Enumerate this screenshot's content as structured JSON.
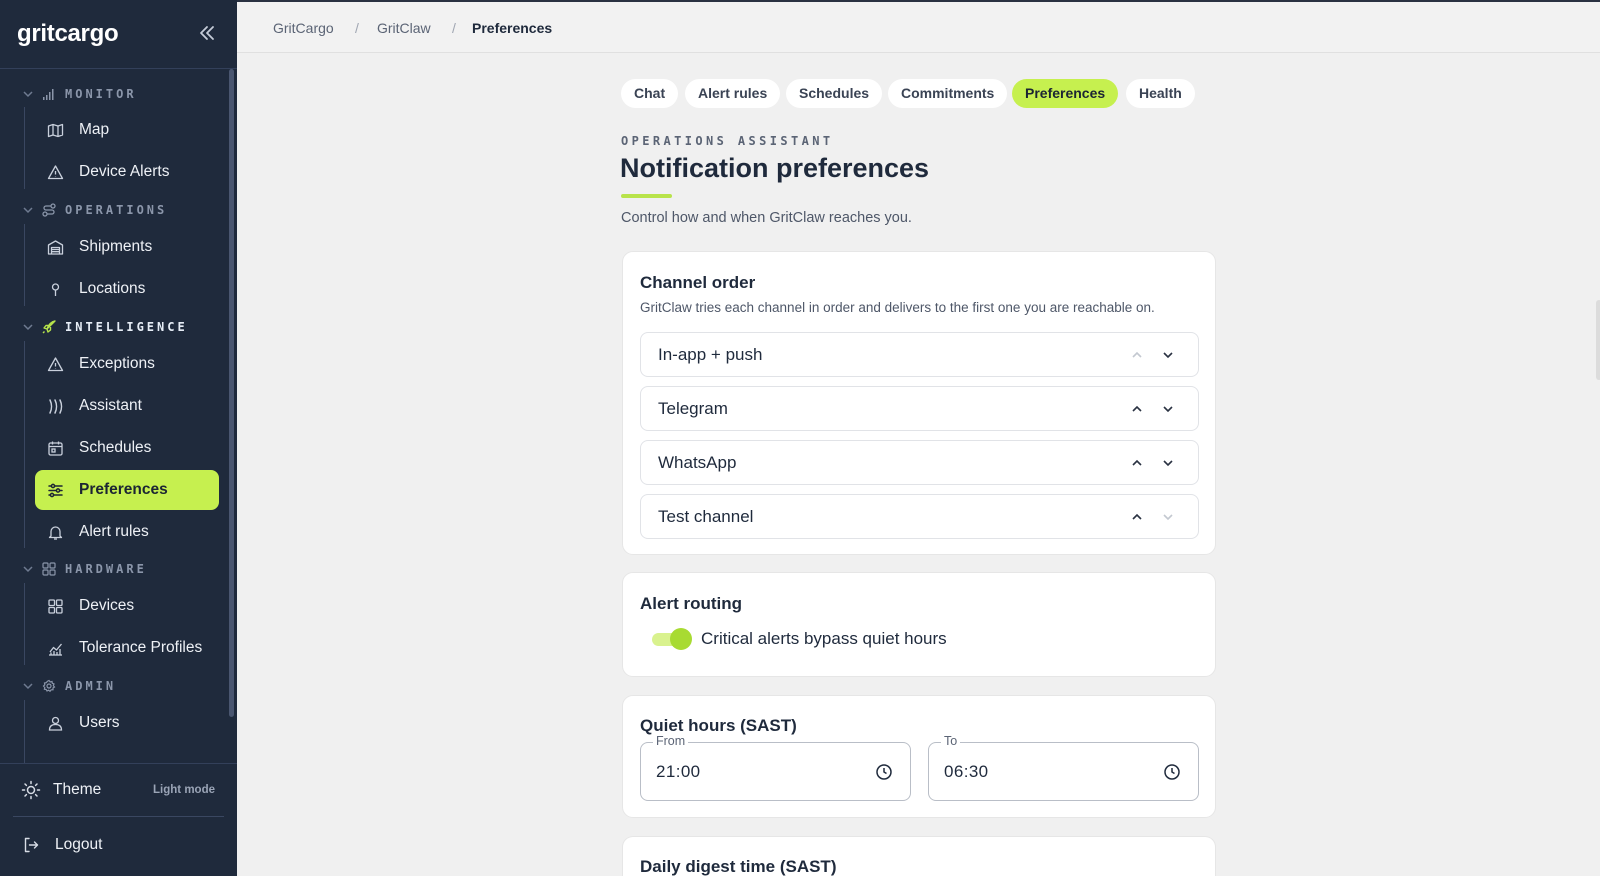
{
  "app": {
    "logo": "gritcargo"
  },
  "sidebar": {
    "sections": [
      {
        "label": "MONITOR",
        "icon": "signal-bars-icon",
        "items": [
          {
            "label": "Map",
            "icon": "map-icon"
          },
          {
            "label": "Device Alerts",
            "icon": "warning-triangle-icon"
          }
        ]
      },
      {
        "label": "OPERATIONS",
        "icon": "route-icon",
        "items": [
          {
            "label": "Shipments",
            "icon": "warehouse-icon"
          },
          {
            "label": "Locations",
            "icon": "pin-icon"
          }
        ]
      },
      {
        "label": "INTELLIGENCE",
        "icon": "rocket-icon",
        "active": true,
        "items": [
          {
            "label": "Exceptions",
            "icon": "warning-triangle-icon"
          },
          {
            "label": "Assistant",
            "icon": "claw-icon"
          },
          {
            "label": "Schedules",
            "icon": "calendar-icon"
          },
          {
            "label": "Preferences",
            "icon": "sliders-icon",
            "active": true
          },
          {
            "label": "Alert rules",
            "icon": "bell-icon"
          }
        ]
      },
      {
        "label": "HARDWARE",
        "icon": "grid-icon",
        "items": [
          {
            "label": "Devices",
            "icon": "grid-icon"
          },
          {
            "label": "Tolerance Profiles",
            "icon": "chart-icon"
          }
        ]
      },
      {
        "label": "ADMIN",
        "icon": "gear-icon",
        "items": [
          {
            "label": "Users",
            "icon": "user-icon"
          }
        ]
      }
    ],
    "footer": {
      "theme_label": "Theme",
      "theme_mode": "Light mode",
      "logout_label": "Logout"
    }
  },
  "breadcrumb": [
    "GritCargo",
    "GritClaw",
    "Preferences"
  ],
  "tabs": [
    {
      "label": "Chat"
    },
    {
      "label": "Alert rules"
    },
    {
      "label": "Schedules"
    },
    {
      "label": "Commitments"
    },
    {
      "label": "Preferences",
      "active": true
    },
    {
      "label": "Health"
    }
  ],
  "page": {
    "eyebrow": "OPERATIONS ASSISTANT",
    "title": "Notification preferences",
    "subtitle": "Control how and when GritClaw reaches you."
  },
  "channel_order": {
    "title": "Channel order",
    "description": "GritClaw tries each channel in order and delivers to the first one you are reachable on.",
    "channels": [
      {
        "label": "In-app + push",
        "up_enabled": false,
        "down_enabled": true
      },
      {
        "label": "Telegram",
        "up_enabled": true,
        "down_enabled": true
      },
      {
        "label": "WhatsApp",
        "up_enabled": true,
        "down_enabled": true
      },
      {
        "label": "Test channel",
        "up_enabled": true,
        "down_enabled": false
      }
    ]
  },
  "alert_routing": {
    "title": "Alert routing",
    "toggle_label": "Critical alerts bypass quiet hours",
    "toggle_on": true
  },
  "quiet_hours": {
    "title": "Quiet hours (SAST)",
    "from_label": "From",
    "from_value": "21:00",
    "to_label": "To",
    "to_value": "06:30"
  },
  "daily_digest": {
    "title": "Daily digest time (SAST)"
  },
  "colors": {
    "accent": "#c6f04f",
    "sidebar_bg": "#1f2a3c",
    "page_bg": "#f0f0f0"
  }
}
